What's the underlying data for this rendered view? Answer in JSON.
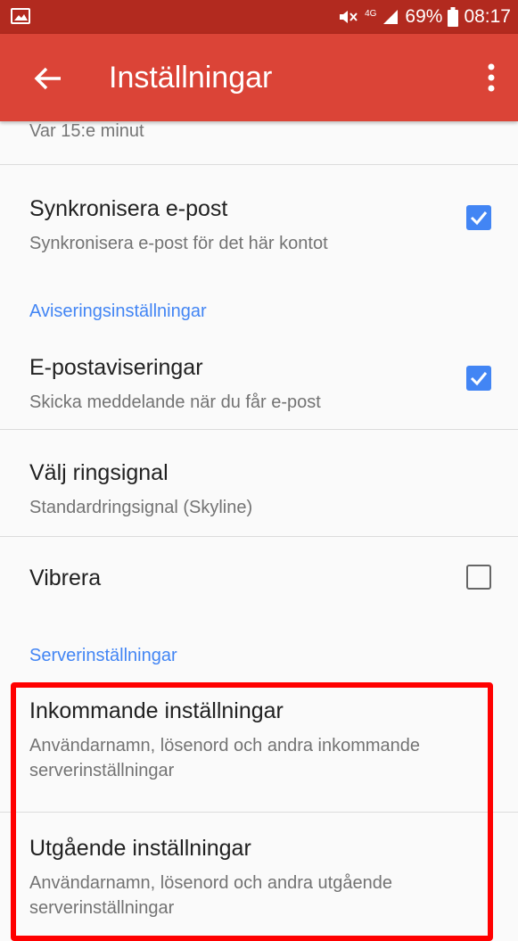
{
  "status_bar": {
    "battery": "69%",
    "time": "08:17",
    "network": "4G"
  },
  "app_bar": {
    "title": "Inställningar"
  },
  "settings": {
    "partial_top": "Var 15:e minut",
    "sync": {
      "title": "Synkronisera e-post",
      "subtitle": "Synkronisera e-post för det här kontot",
      "checked": true
    },
    "notifications_header": "Aviseringsinställningar",
    "email_notifications": {
      "title": "E-postaviseringar",
      "subtitle": "Skicka meddelande när du får e-post",
      "checked": true
    },
    "ringtone": {
      "title": "Välj ringsignal",
      "subtitle": "Standardringsignal (Skyline)"
    },
    "vibrate": {
      "title": "Vibrera",
      "checked": false
    },
    "server_header": "Serverinställningar",
    "incoming": {
      "title": "Inkommande inställningar",
      "subtitle_line1": "Användarnamn, lösenord och andra inkommande",
      "subtitle_line2": "serverinställningar"
    },
    "outgoing": {
      "title": "Utgående inställningar",
      "subtitle_line1": "Användarnamn, lösenord och andra utgående",
      "subtitle_line2": "serverinställningar"
    }
  },
  "colors": {
    "status_bar": "#b22a1f",
    "app_bar": "#db4437",
    "accent": "#4285f4",
    "highlight": "#ff0000"
  }
}
